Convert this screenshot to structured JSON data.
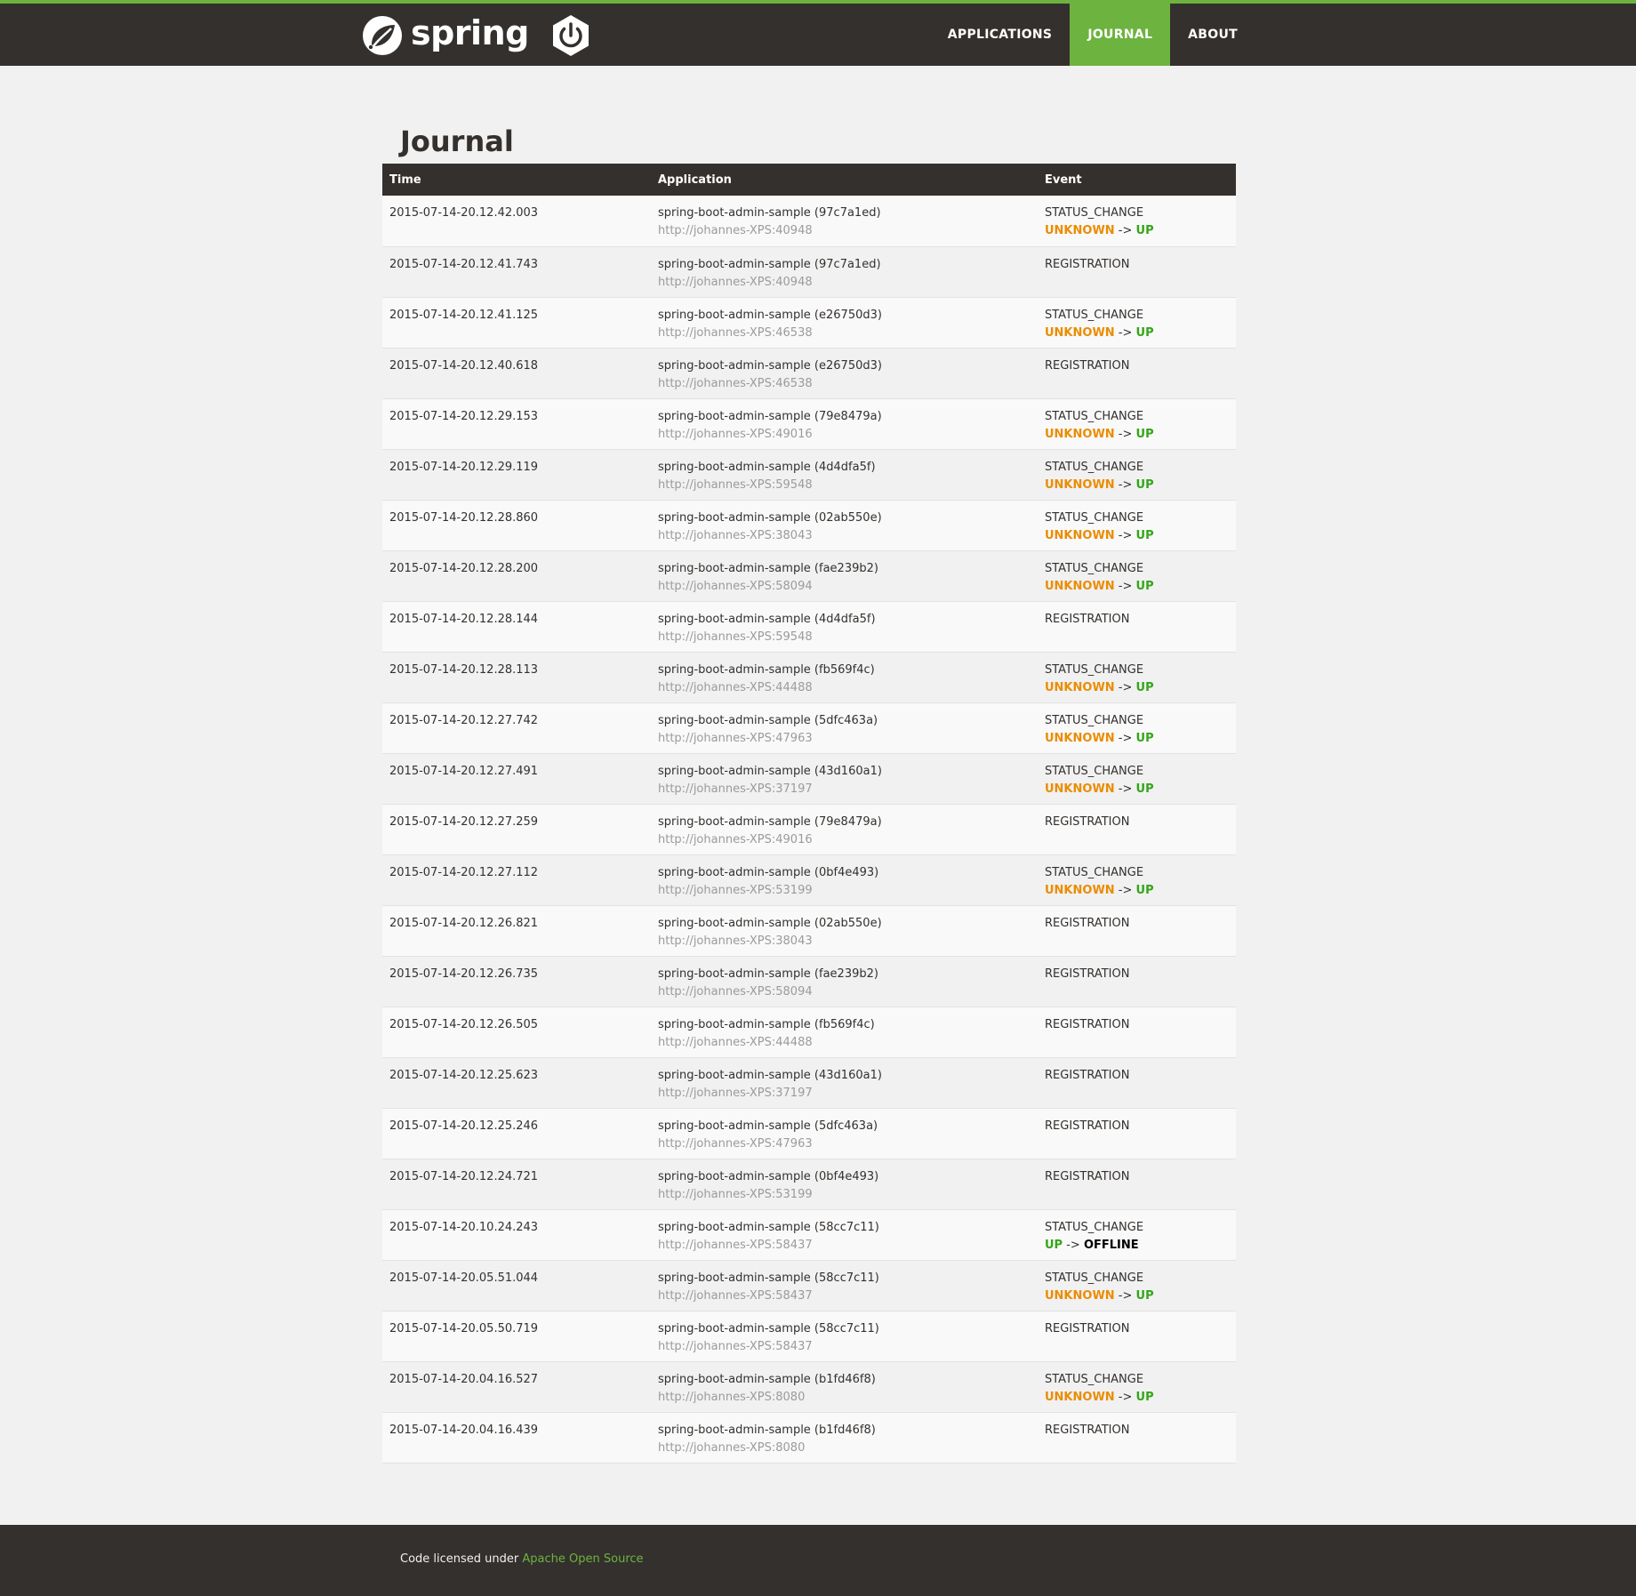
{
  "colors": {
    "accent": "#6db33f",
    "dark": "#34302d",
    "unknown": "#eb8c00",
    "up": "#34a619",
    "offline": "#000000"
  },
  "brand": {
    "wordmark": "spring",
    "logo_icon": "spring-leaf-icon",
    "power_icon": "power-icon"
  },
  "nav": [
    {
      "label": "APPLICATIONS",
      "active": false
    },
    {
      "label": "JOURNAL",
      "active": true
    },
    {
      "label": "ABOUT",
      "active": false
    }
  ],
  "page": {
    "title": "Journal"
  },
  "table": {
    "headers": {
      "time": "Time",
      "application": "Application",
      "event": "Event"
    },
    "rows": [
      {
        "time": "2015-07-14-20.12.42.003",
        "app": "spring-boot-admin-sample (97c7a1ed)",
        "url": "http://johannes-XPS:40948",
        "event": "STATUS_CHANGE",
        "from": "UNKNOWN",
        "to": "UP"
      },
      {
        "time": "2015-07-14-20.12.41.743",
        "app": "spring-boot-admin-sample (97c7a1ed)",
        "url": "http://johannes-XPS:40948",
        "event": "REGISTRATION"
      },
      {
        "time": "2015-07-14-20.12.41.125",
        "app": "spring-boot-admin-sample (e26750d3)",
        "url": "http://johannes-XPS:46538",
        "event": "STATUS_CHANGE",
        "from": "UNKNOWN",
        "to": "UP"
      },
      {
        "time": "2015-07-14-20.12.40.618",
        "app": "spring-boot-admin-sample (e26750d3)",
        "url": "http://johannes-XPS:46538",
        "event": "REGISTRATION"
      },
      {
        "time": "2015-07-14-20.12.29.153",
        "app": "spring-boot-admin-sample (79e8479a)",
        "url": "http://johannes-XPS:49016",
        "event": "STATUS_CHANGE",
        "from": "UNKNOWN",
        "to": "UP"
      },
      {
        "time": "2015-07-14-20.12.29.119",
        "app": "spring-boot-admin-sample (4d4dfa5f)",
        "url": "http://johannes-XPS:59548",
        "event": "STATUS_CHANGE",
        "from": "UNKNOWN",
        "to": "UP"
      },
      {
        "time": "2015-07-14-20.12.28.860",
        "app": "spring-boot-admin-sample (02ab550e)",
        "url": "http://johannes-XPS:38043",
        "event": "STATUS_CHANGE",
        "from": "UNKNOWN",
        "to": "UP"
      },
      {
        "time": "2015-07-14-20.12.28.200",
        "app": "spring-boot-admin-sample (fae239b2)",
        "url": "http://johannes-XPS:58094",
        "event": "STATUS_CHANGE",
        "from": "UNKNOWN",
        "to": "UP"
      },
      {
        "time": "2015-07-14-20.12.28.144",
        "app": "spring-boot-admin-sample (4d4dfa5f)",
        "url": "http://johannes-XPS:59548",
        "event": "REGISTRATION"
      },
      {
        "time": "2015-07-14-20.12.28.113",
        "app": "spring-boot-admin-sample (fb569f4c)",
        "url": "http://johannes-XPS:44488",
        "event": "STATUS_CHANGE",
        "from": "UNKNOWN",
        "to": "UP"
      },
      {
        "time": "2015-07-14-20.12.27.742",
        "app": "spring-boot-admin-sample (5dfc463a)",
        "url": "http://johannes-XPS:47963",
        "event": "STATUS_CHANGE",
        "from": "UNKNOWN",
        "to": "UP"
      },
      {
        "time": "2015-07-14-20.12.27.491",
        "app": "spring-boot-admin-sample (43d160a1)",
        "url": "http://johannes-XPS:37197",
        "event": "STATUS_CHANGE",
        "from": "UNKNOWN",
        "to": "UP"
      },
      {
        "time": "2015-07-14-20.12.27.259",
        "app": "spring-boot-admin-sample (79e8479a)",
        "url": "http://johannes-XPS:49016",
        "event": "REGISTRATION"
      },
      {
        "time": "2015-07-14-20.12.27.112",
        "app": "spring-boot-admin-sample (0bf4e493)",
        "url": "http://johannes-XPS:53199",
        "event": "STATUS_CHANGE",
        "from": "UNKNOWN",
        "to": "UP"
      },
      {
        "time": "2015-07-14-20.12.26.821",
        "app": "spring-boot-admin-sample (02ab550e)",
        "url": "http://johannes-XPS:38043",
        "event": "REGISTRATION"
      },
      {
        "time": "2015-07-14-20.12.26.735",
        "app": "spring-boot-admin-sample (fae239b2)",
        "url": "http://johannes-XPS:58094",
        "event": "REGISTRATION"
      },
      {
        "time": "2015-07-14-20.12.26.505",
        "app": "spring-boot-admin-sample (fb569f4c)",
        "url": "http://johannes-XPS:44488",
        "event": "REGISTRATION"
      },
      {
        "time": "2015-07-14-20.12.25.623",
        "app": "spring-boot-admin-sample (43d160a1)",
        "url": "http://johannes-XPS:37197",
        "event": "REGISTRATION"
      },
      {
        "time": "2015-07-14-20.12.25.246",
        "app": "spring-boot-admin-sample (5dfc463a)",
        "url": "http://johannes-XPS:47963",
        "event": "REGISTRATION"
      },
      {
        "time": "2015-07-14-20.12.24.721",
        "app": "spring-boot-admin-sample (0bf4e493)",
        "url": "http://johannes-XPS:53199",
        "event": "REGISTRATION"
      },
      {
        "time": "2015-07-14-20.10.24.243",
        "app": "spring-boot-admin-sample (58cc7c11)",
        "url": "http://johannes-XPS:58437",
        "event": "STATUS_CHANGE",
        "from": "UP",
        "to": "OFFLINE"
      },
      {
        "time": "2015-07-14-20.05.51.044",
        "app": "spring-boot-admin-sample (58cc7c11)",
        "url": "http://johannes-XPS:58437",
        "event": "STATUS_CHANGE",
        "from": "UNKNOWN",
        "to": "UP"
      },
      {
        "time": "2015-07-14-20.05.50.719",
        "app": "spring-boot-admin-sample (58cc7c11)",
        "url": "http://johannes-XPS:58437",
        "event": "REGISTRATION"
      },
      {
        "time": "2015-07-14-20.04.16.527",
        "app": "spring-boot-admin-sample (b1fd46f8)",
        "url": "http://johannes-XPS:8080",
        "event": "STATUS_CHANGE",
        "from": "UNKNOWN",
        "to": "UP"
      },
      {
        "time": "2015-07-14-20.04.16.439",
        "app": "spring-boot-admin-sample (b1fd46f8)",
        "url": "http://johannes-XPS:8080",
        "event": "REGISTRATION"
      }
    ]
  },
  "footer": {
    "text": "Code licensed under",
    "link_label": "Apache Open Source"
  }
}
